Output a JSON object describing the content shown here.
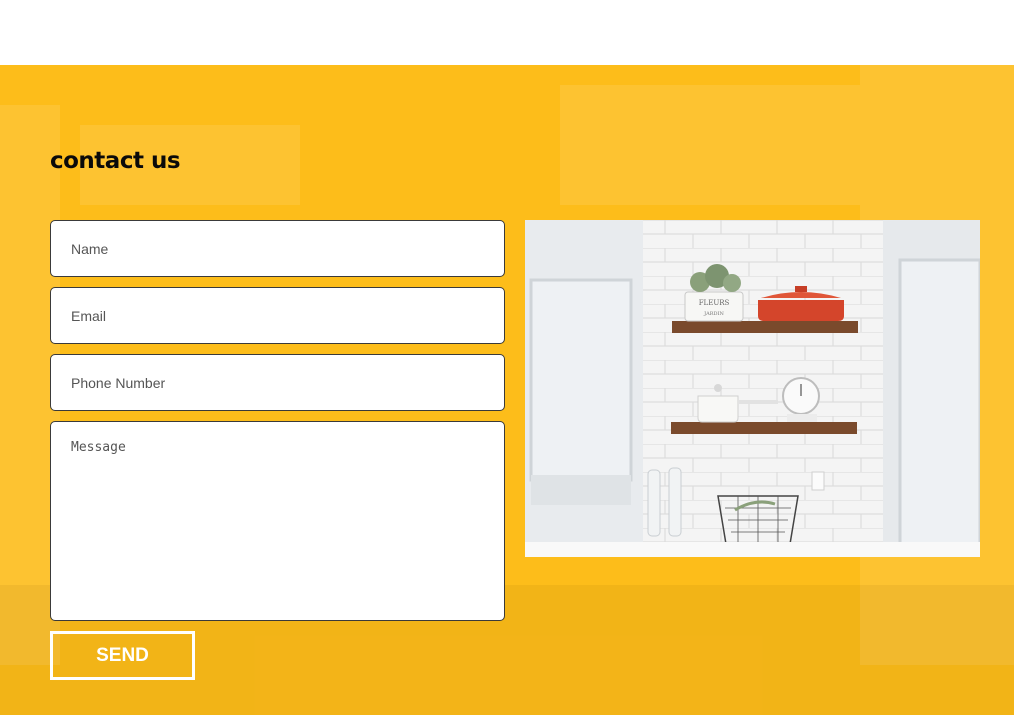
{
  "contact": {
    "heading": "contact us",
    "form": {
      "name_placeholder": "Name",
      "email_placeholder": "Email",
      "phone_placeholder": "Phone Number",
      "message_placeholder": "Message",
      "send_label": "SEND"
    },
    "photo": {
      "jar_label_line1": "FLEURS",
      "jar_label_line2": "JARDIN"
    }
  },
  "colors": {
    "section_background": "#fdbd1a",
    "field_background": "#ffffff",
    "field_border": "#3a3a3a",
    "heading_text": "#0a0a0a",
    "button_border": "#ffffff"
  }
}
